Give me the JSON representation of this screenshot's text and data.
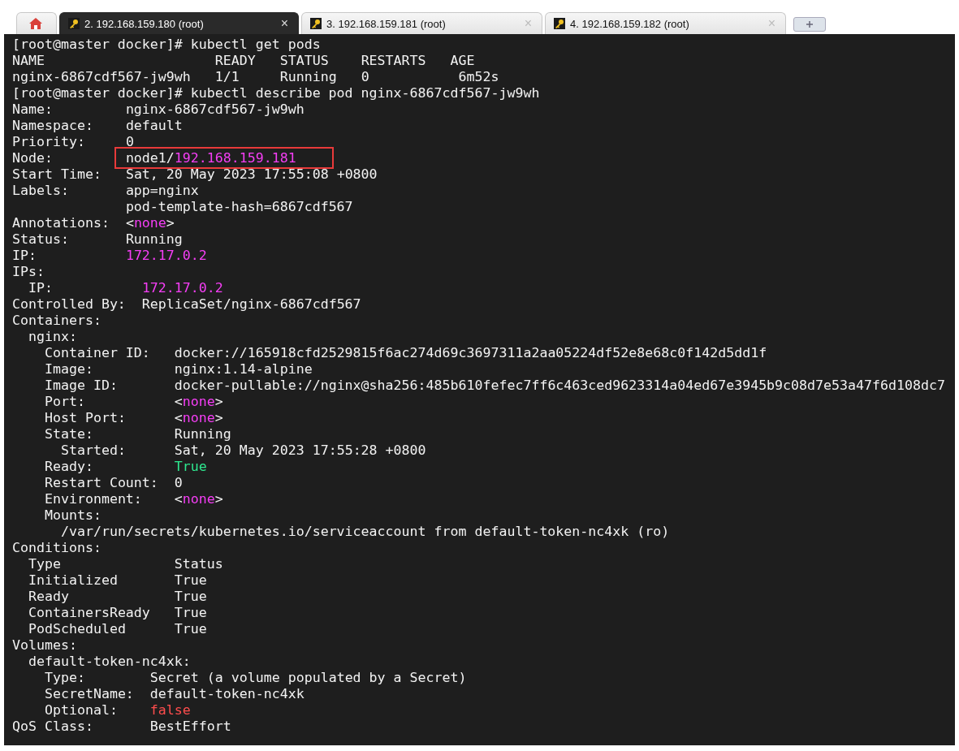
{
  "tabs": [
    {
      "kind": "home",
      "selected": false
    },
    {
      "kind": "session",
      "label": "2. 192.168.159.180 (root)",
      "close": "×",
      "selected": true
    },
    {
      "kind": "session",
      "label": "3. 192.168.159.181 (root)",
      "close": "×",
      "selected": false
    },
    {
      "kind": "session",
      "label": "4. 192.168.159.182 (root)",
      "close": "×",
      "selected": false
    },
    {
      "kind": "new"
    }
  ],
  "terminal": {
    "lines": [
      {
        "segments": [
          {
            "text": "[root@master docker]# kubectl get pods"
          }
        ]
      },
      {
        "segments": [
          {
            "text": "NAME"
          },
          {
            "text": "                     READY"
          },
          {
            "text": "   STATUS"
          },
          {
            "text": "    RESTARTS"
          },
          {
            "text": "   AGE"
          }
        ]
      },
      {
        "segments": [
          {
            "text": "nginx-6867cdf567-jw9wh"
          },
          {
            "text": "   1/1"
          },
          {
            "text": "     Running"
          },
          {
            "text": "   0"
          },
          {
            "text": "           6m52s"
          }
        ]
      },
      {
        "segments": [
          {
            "text": "[root@master docker]# kubectl describe pod nginx-6867cdf567-jw9wh"
          }
        ]
      },
      {
        "segments": [
          {
            "text": "Name:"
          },
          {
            "text": "         nginx-6867cdf567-jw9wh"
          }
        ]
      },
      {
        "segments": [
          {
            "text": "Namespace:"
          },
          {
            "text": "    default"
          }
        ]
      },
      {
        "segments": [
          {
            "text": "Priority:"
          },
          {
            "text": "     0"
          }
        ]
      },
      {
        "segments": [
          {
            "text": "Node:         "
          },
          {
            "kind": "box",
            "segments": [
              {
                "text": "node1/"
              },
              {
                "text": "192.168.159.181",
                "kind": "magenta"
              }
            ]
          }
        ]
      },
      {
        "segments": [
          {
            "text": "Start Time:"
          },
          {
            "text": "   Sat, 20 May 2023 17:55:08 +0800"
          }
        ]
      },
      {
        "segments": [
          {
            "text": "Labels:"
          },
          {
            "text": "       app=nginx"
          }
        ]
      },
      {
        "segments": [
          {
            "text": "              pod-template-hash=6867cdf567"
          }
        ]
      },
      {
        "segments": [
          {
            "text": "Annotations:"
          },
          {
            "text": "  <"
          },
          {
            "text": "none",
            "kind": "magenta"
          },
          {
            "text": ">"
          }
        ]
      },
      {
        "segments": [
          {
            "text": "Status:"
          },
          {
            "text": "       Running"
          }
        ]
      },
      {
        "segments": [
          {
            "text": "IP:"
          },
          {
            "text": "           172.17.0.2",
            "kind": "magenta"
          }
        ]
      },
      {
        "segments": [
          {
            "text": "IPs:"
          }
        ]
      },
      {
        "segments": [
          {
            "text": "  IP:"
          },
          {
            "text": "           172.17.0.2",
            "kind": "magenta"
          }
        ]
      },
      {
        "segments": [
          {
            "text": "Controlled By:"
          },
          {
            "text": "  ReplicaSet/nginx-6867cdf567"
          }
        ]
      },
      {
        "segments": [
          {
            "text": "Containers:"
          }
        ]
      },
      {
        "segments": [
          {
            "text": "  nginx:"
          }
        ]
      },
      {
        "segments": [
          {
            "text": "    Container ID:"
          },
          {
            "text": "   docker://165918cfd2529815f6ac274d69c3697311a2aa05224df52e8e68c0f142d5dd1f"
          }
        ]
      },
      {
        "segments": [
          {
            "text": "    Image:"
          },
          {
            "text": "          nginx:1.14-alpine"
          }
        ]
      },
      {
        "segments": [
          {
            "text": "    Image ID:"
          },
          {
            "text": "       docker-pullable://nginx@sha256:485b610fefec7ff6c463ced9623314a04ed67e3945b9c08d7e53a47f6d108dc7"
          }
        ]
      },
      {
        "segments": [
          {
            "text": "    Port:"
          },
          {
            "text": "           <"
          },
          {
            "text": "none",
            "kind": "magenta"
          },
          {
            "text": ">"
          }
        ]
      },
      {
        "segments": [
          {
            "text": "    Host Port:"
          },
          {
            "text": "      <"
          },
          {
            "text": "none",
            "kind": "magenta"
          },
          {
            "text": ">"
          }
        ]
      },
      {
        "segments": [
          {
            "text": "    State:"
          },
          {
            "text": "          Running"
          }
        ]
      },
      {
        "segments": [
          {
            "text": "      Started:"
          },
          {
            "text": "      Sat, 20 May 2023 17:55:28 +0800"
          }
        ]
      },
      {
        "segments": [
          {
            "text": "    Ready:"
          },
          {
            "text": "          True",
            "kind": "green"
          }
        ]
      },
      {
        "segments": [
          {
            "text": "    Restart Count:"
          },
          {
            "text": "  0"
          }
        ]
      },
      {
        "segments": [
          {
            "text": "    Environment:"
          },
          {
            "text": "    <"
          },
          {
            "text": "none",
            "kind": "magenta"
          },
          {
            "text": ">"
          }
        ]
      },
      {
        "segments": [
          {
            "text": "    Mounts:"
          }
        ]
      },
      {
        "segments": [
          {
            "text": "      /var/run/secrets/kubernetes.io/serviceaccount from default-token-nc4xk (ro)"
          }
        ]
      },
      {
        "segments": [
          {
            "text": "Conditions:"
          }
        ]
      },
      {
        "segments": [
          {
            "text": "  Type"
          },
          {
            "text": "              Status"
          }
        ]
      },
      {
        "segments": [
          {
            "text": "  Initialized"
          },
          {
            "text": "       True"
          }
        ]
      },
      {
        "segments": [
          {
            "text": "  Ready"
          },
          {
            "text": "             True"
          }
        ]
      },
      {
        "segments": [
          {
            "text": "  ContainersReady"
          },
          {
            "text": "   True"
          }
        ]
      },
      {
        "segments": [
          {
            "text": "  PodScheduled"
          },
          {
            "text": "      True"
          }
        ]
      },
      {
        "segments": [
          {
            "text": "Volumes:"
          }
        ]
      },
      {
        "segments": [
          {
            "text": "  default-token-nc4xk:"
          }
        ]
      },
      {
        "segments": [
          {
            "text": "    Type:"
          },
          {
            "text": "        Secret (a volume populated by a Secret)"
          }
        ]
      },
      {
        "segments": [
          {
            "text": "    SecretName:"
          },
          {
            "text": "  default-token-nc4xk"
          }
        ]
      },
      {
        "segments": [
          {
            "text": "    Optional:"
          },
          {
            "text": "    false",
            "kind": "red"
          }
        ]
      },
      {
        "segments": [
          {
            "text": "QoS Class:"
          },
          {
            "text": "       BestEffort"
          }
        ]
      }
    ]
  }
}
